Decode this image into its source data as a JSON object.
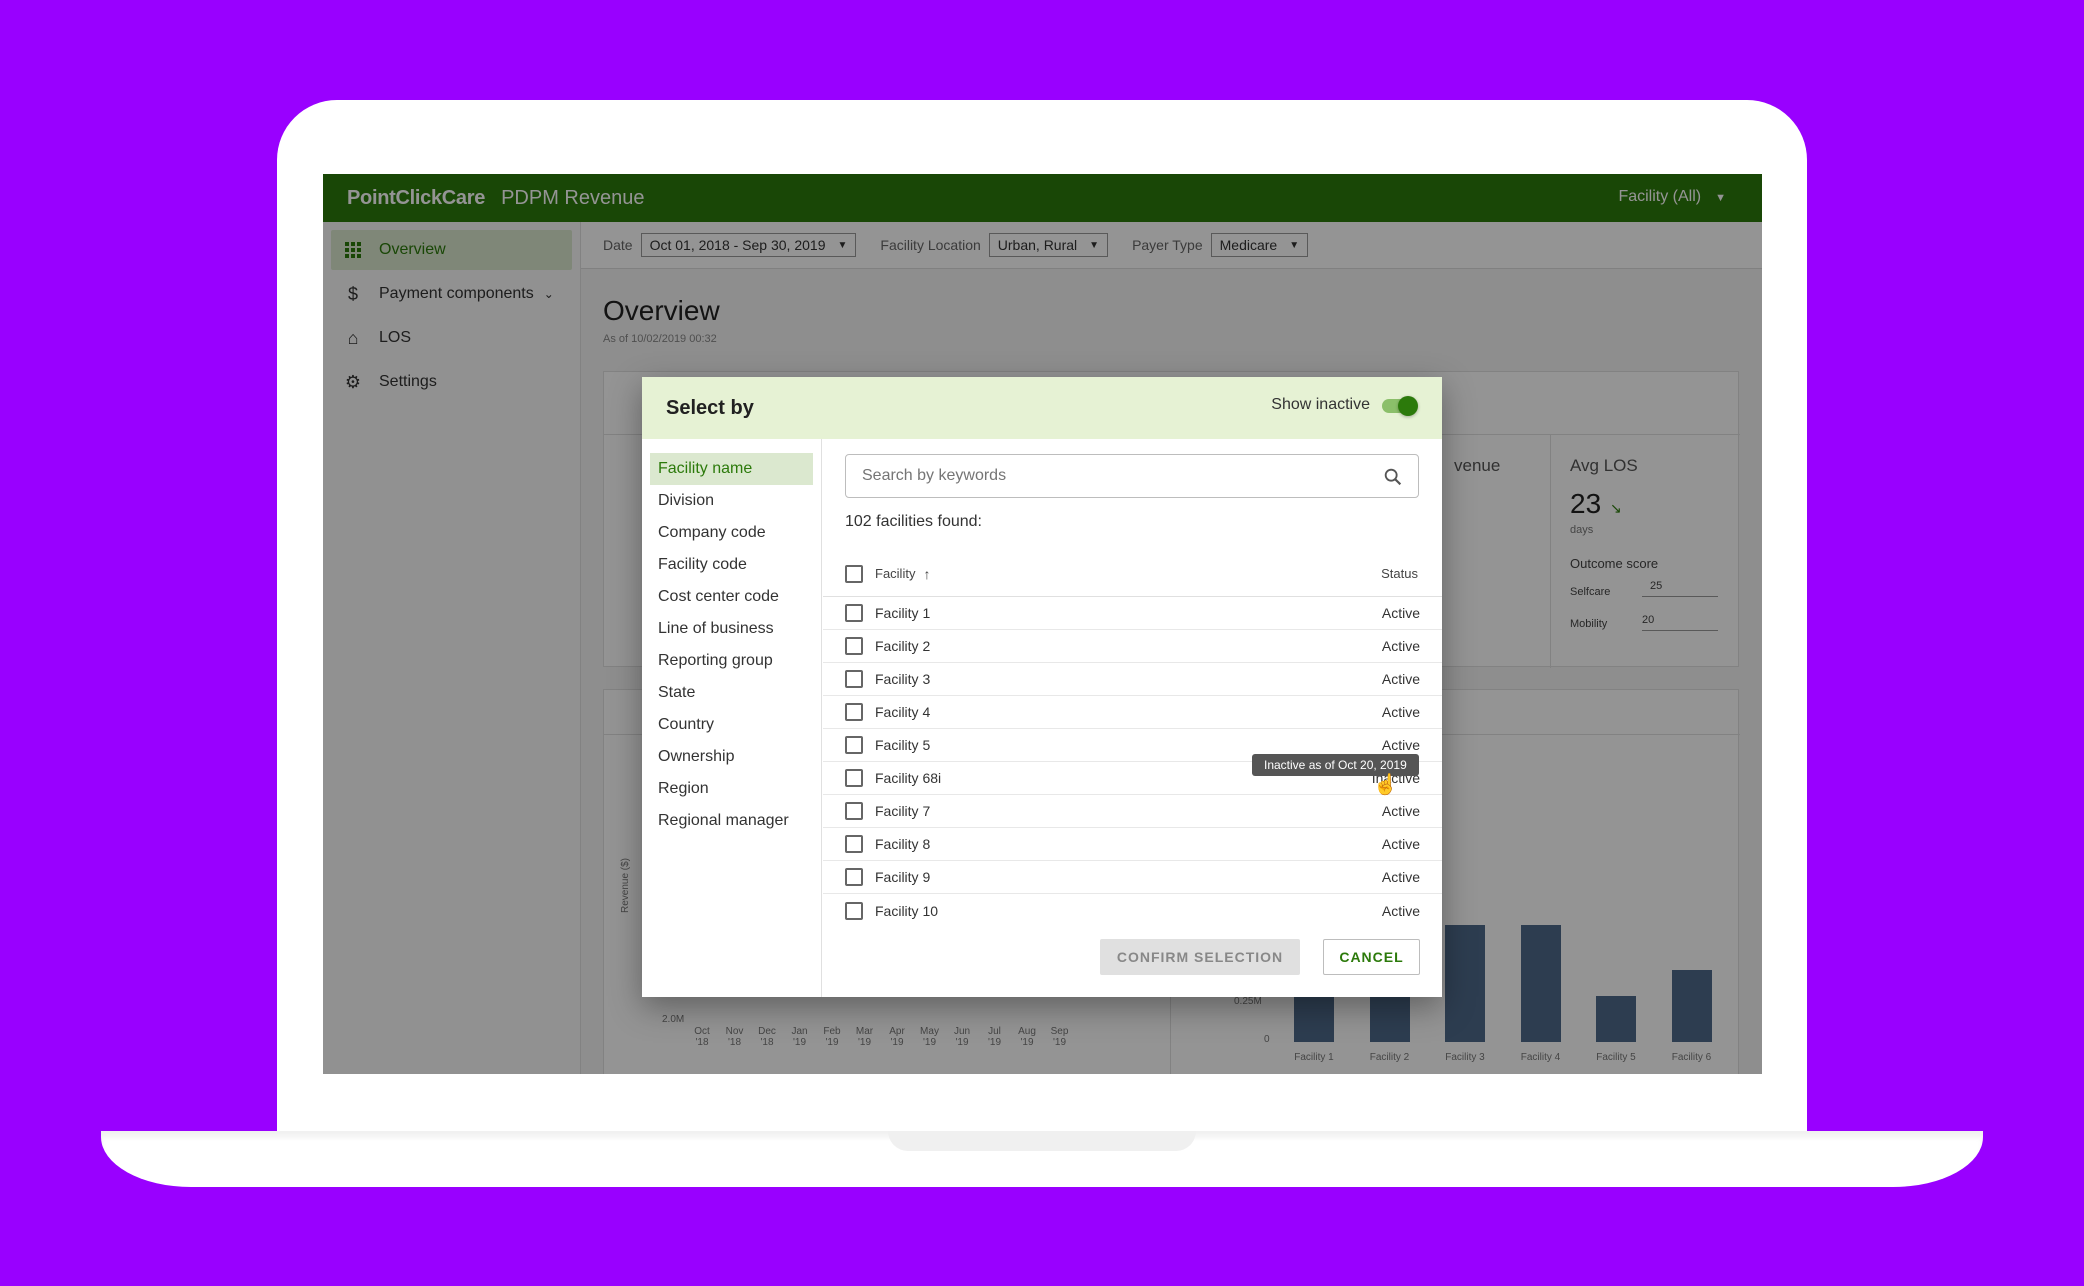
{
  "app": {
    "brand": "PointClickCare",
    "title": "PDPM Revenue",
    "facility_selector": "Facility (All)"
  },
  "sidebar": {
    "items": [
      {
        "label": "Overview",
        "icon": "grid-icon"
      },
      {
        "label": "Payment components",
        "icon": "dollar-icon"
      },
      {
        "label": "LOS",
        "icon": "house-clock-icon"
      },
      {
        "label": "Settings",
        "icon": "gear-icon"
      }
    ]
  },
  "filters": {
    "date_label": "Date",
    "date_value": "Oct 01, 2018 - Sep 30, 2019",
    "location_label": "Facility Location",
    "location_value": "Urban, Rural",
    "payer_label": "Payer Type",
    "payer_value": "Medicare"
  },
  "overview": {
    "title": "Overview",
    "as_of": "As of 10/02/2019 00:32",
    "revenue_fragment": "venue",
    "avg_los_label": "Avg LOS",
    "avg_los_value": "23",
    "avg_los_unit": "days",
    "outcome_label": "Outcome score",
    "selfcare_label": "Selfcare",
    "selfcare_value": "25",
    "mobility_label": "Mobility",
    "mobility_value": "20",
    "y_axis_label": "Revenue ($)",
    "left_chart_ytick": "2.0M",
    "left_chart_months": [
      "Oct '18",
      "Nov '18",
      "Dec '18",
      "Jan '19",
      "Feb '19",
      "Mar '19",
      "Apr '19",
      "May '19",
      "Jun '19",
      "Jul '19",
      "Aug '19",
      "Sep '19"
    ],
    "right_chart_yticks": [
      "0.25M",
      "0"
    ],
    "right_chart_facilities": [
      "Facility 1",
      "Facility 2",
      "Facility 3",
      "Facility 4",
      "Facility 5",
      "Facility 6"
    ]
  },
  "dialog": {
    "title": "Select by",
    "show_inactive_label": "Show inactive",
    "show_inactive_on": true,
    "options": [
      "Facility name",
      "Division",
      "Company code",
      "Facility code",
      "Cost center code",
      "Line of business",
      "Reporting group",
      "State",
      "Country",
      "Ownership",
      "Region",
      "Regional manager"
    ],
    "selected_option": "Facility name",
    "search_placeholder": "Search by keywords",
    "found_text": "102 facilities found:",
    "col_facility": "Facility",
    "col_status": "Status",
    "rows": [
      {
        "name": "Facility 1",
        "status": "Active"
      },
      {
        "name": "Facility 2",
        "status": "Active"
      },
      {
        "name": "Facility 3",
        "status": "Active"
      },
      {
        "name": "Facility 4",
        "status": "Active"
      },
      {
        "name": "Facility 5",
        "status": "Active"
      },
      {
        "name": "Facility 68i",
        "status": "Inactive"
      },
      {
        "name": "Facility 7",
        "status": "Active"
      },
      {
        "name": "Facility 8",
        "status": "Active"
      },
      {
        "name": "Facility 9",
        "status": "Active"
      },
      {
        "name": "Facility 10",
        "status": "Active"
      }
    ],
    "tooltip": "Inactive as of Oct 20, 2019",
    "confirm_label": "CONFIRM SELECTION",
    "cancel_label": "CANCEL"
  },
  "colors": {
    "background": "#9900ff",
    "brand_green": "#2c7a0b",
    "dialog_header": "#e6f2d4",
    "bar": "#4e6a8a"
  }
}
